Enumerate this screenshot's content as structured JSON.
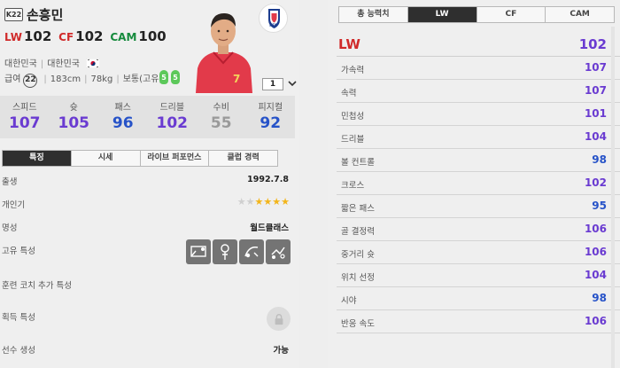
{
  "player": {
    "season_badge": "K22",
    "name": "손흥민",
    "positions": [
      {
        "abbr": "LW",
        "value": "102",
        "group": "fw"
      },
      {
        "abbr": "CF",
        "value": "102",
        "group": "fw"
      },
      {
        "abbr": "CAM",
        "value": "100",
        "group": "mf"
      }
    ],
    "nationality": "대한민국",
    "nationality2": "대한민국",
    "pay_label": "급여",
    "pay": "22",
    "height": "183cm",
    "weight": "78kg",
    "body_type": "보통(고유)",
    "left_foot": "5",
    "right_foot": "5",
    "enhance_level": "1",
    "team_logo_text": "KFA"
  },
  "stats": [
    {
      "label": "스피드",
      "value": "107",
      "color": "#6a3bd1"
    },
    {
      "label": "슛",
      "value": "105",
      "color": "#6a3bd1"
    },
    {
      "label": "패스",
      "value": "96",
      "color": "#2753c8"
    },
    {
      "label": "드리블",
      "value": "102",
      "color": "#6a3bd1"
    },
    {
      "label": "수비",
      "value": "55",
      "color": "#9a9a9a"
    },
    {
      "label": "피지컬",
      "value": "92",
      "color": "#2753c8"
    }
  ],
  "left_tabs": [
    "특징",
    "시세",
    "라이브 퍼포먼스",
    "클럽 경력"
  ],
  "details": {
    "birth_label": "출생",
    "birth_value": "1992.7.8",
    "skill_label": "개인기",
    "skill_stars": 4,
    "skill_max": 6,
    "reputation_label": "명성",
    "reputation_value": "월드클래스",
    "traits_label": "고유 특성",
    "trait_icons": [
      "finesse-shot-icon",
      "long-shot-icon",
      "flair-icon",
      "speed-dribbler-icon"
    ],
    "coach_label": "훈련 코치 추가 특성",
    "acquired_label": "획득 특성",
    "create_label": "선수 생성",
    "create_value": "가능"
  },
  "right_tabs": [
    "총 능력치",
    "LW",
    "CF",
    "CAM"
  ],
  "overall": {
    "label": "LW",
    "value": "102"
  },
  "attributes": [
    {
      "label": "가속력",
      "value": "107",
      "color": "#6a3bd1"
    },
    {
      "label": "속력",
      "value": "107",
      "color": "#6a3bd1"
    },
    {
      "label": "민첩성",
      "value": "101",
      "color": "#6a3bd1"
    },
    {
      "label": "드리블",
      "value": "104",
      "color": "#6a3bd1"
    },
    {
      "label": "볼 컨트롤",
      "value": "98",
      "color": "#2753c8"
    },
    {
      "label": "크로스",
      "value": "102",
      "color": "#6a3bd1"
    },
    {
      "label": "짧은 패스",
      "value": "95",
      "color": "#2753c8"
    },
    {
      "label": "골 결정력",
      "value": "106",
      "color": "#6a3bd1"
    },
    {
      "label": "중거리 슛",
      "value": "106",
      "color": "#6a3bd1"
    },
    {
      "label": "위치 선정",
      "value": "104",
      "color": "#6a3bd1"
    },
    {
      "label": "시야",
      "value": "98",
      "color": "#2753c8"
    },
    {
      "label": "반응 속도",
      "value": "106",
      "color": "#6a3bd1"
    }
  ]
}
